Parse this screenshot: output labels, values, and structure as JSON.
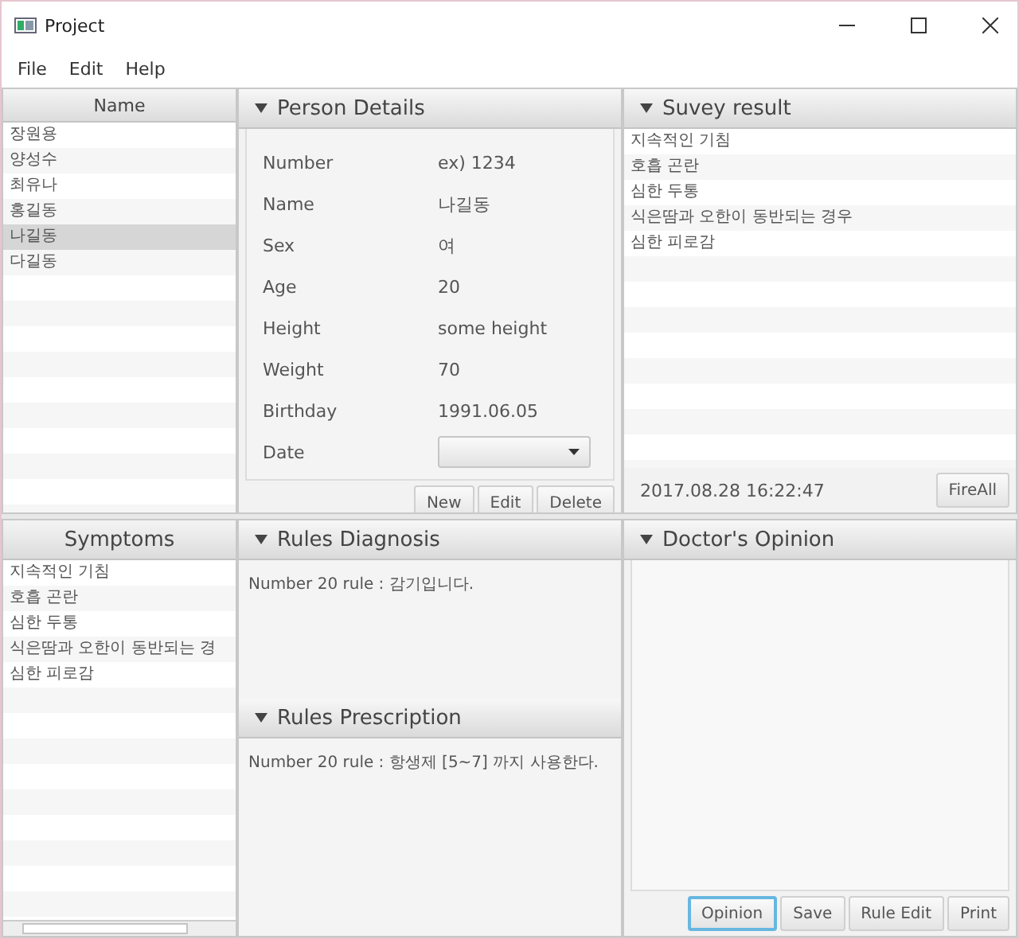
{
  "window": {
    "title": "Project"
  },
  "menu": [
    "File",
    "Edit",
    "Help"
  ],
  "name_list": {
    "header": "Name",
    "items": [
      {
        "label": "장원용",
        "selected": false
      },
      {
        "label": "양성수",
        "selected": false
      },
      {
        "label": "최유나",
        "selected": false
      },
      {
        "label": "홍길동",
        "selected": false
      },
      {
        "label": "나길동",
        "selected": true
      },
      {
        "label": "다길동",
        "selected": false
      }
    ]
  },
  "person_details": {
    "title": "Person Details",
    "fields": [
      {
        "label": "Number",
        "value": "ex) 1234",
        "kind": "text"
      },
      {
        "label": "Name",
        "value": "나길동",
        "kind": "text"
      },
      {
        "label": "Sex",
        "value": "여",
        "kind": "text"
      },
      {
        "label": "Age",
        "value": "20",
        "kind": "text"
      },
      {
        "label": "Height",
        "value": "some height",
        "kind": "text"
      },
      {
        "label": "Weight",
        "value": "70",
        "kind": "text"
      },
      {
        "label": "Birthday",
        "value": "1991.06.05",
        "kind": "text"
      },
      {
        "label": "Date",
        "kind": "dropdown"
      }
    ],
    "buttons": [
      {
        "label": "New",
        "focused": false
      },
      {
        "label": "Edit",
        "focused": false
      },
      {
        "label": "Delete",
        "focused": false
      }
    ]
  },
  "survey_result": {
    "title": "Suvey result",
    "items": [
      "지속적인 기침",
      "호흡 곤란",
      "심한 두통",
      "식은땀과 오한이 동반되는 경우",
      "심한 피로감"
    ],
    "timestamp": "2017.08.28 16:22:47",
    "buttons": [
      {
        "label": "FireAll",
        "focused": false
      }
    ]
  },
  "symptoms": {
    "header": "Symptoms",
    "items": [
      "지속적인 기침",
      "호흡 곤란",
      "심한 두통",
      "식은땀과 오한이 동반되는 경",
      "심한 피로감"
    ]
  },
  "rules_diagnosis": {
    "title": "Rules Diagnosis",
    "text": "Number 20 rule : 감기입니다."
  },
  "rules_prescription": {
    "title": "Rules Prescription",
    "text": "Number 20 rule : 항생제 [5~7] 까지 사용한다."
  },
  "doctors_opinion": {
    "title": "Doctor's Opinion",
    "buttons": [
      {
        "label": "Opinion",
        "focused": true
      },
      {
        "label": "Save",
        "focused": false
      },
      {
        "label": "Rule Edit",
        "focused": false
      },
      {
        "label": "Print",
        "focused": false
      }
    ]
  }
}
